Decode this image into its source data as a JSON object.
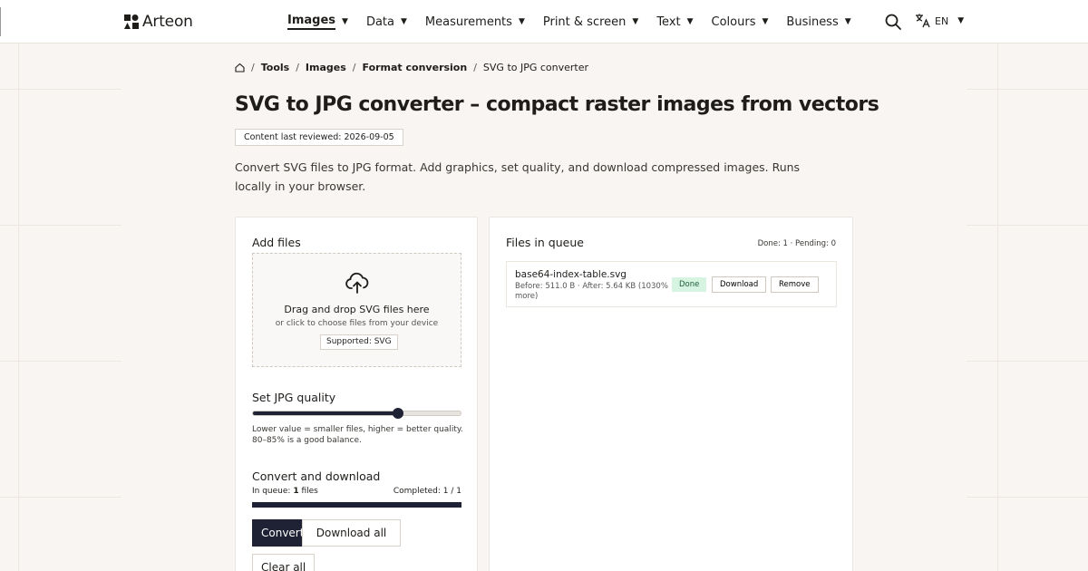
{
  "header": {
    "brand": "Arteon",
    "nav": [
      {
        "label": "Images",
        "active": true
      },
      {
        "label": "Data",
        "active": false
      },
      {
        "label": "Measurements",
        "active": false
      },
      {
        "label": "Print & screen",
        "active": false
      },
      {
        "label": "Text",
        "active": false
      },
      {
        "label": "Colours",
        "active": false
      },
      {
        "label": "Business",
        "active": false
      }
    ],
    "language": "EN",
    "icons": {
      "search": "search-icon",
      "language": "translate-icon",
      "caret": "caret-down-icon"
    }
  },
  "breadcrumb": {
    "home_icon": "home-icon",
    "items": [
      "Tools",
      "Images",
      "Format conversion",
      "SVG to JPG converter"
    ]
  },
  "page": {
    "title": "SVG to JPG converter – compact raster images from vectors",
    "reviewed": "Content last reviewed: 2026-09-05",
    "intro": "Convert SVG files to JPG format. Add graphics, set quality, and download compressed images. Runs locally in your browser."
  },
  "add_files": {
    "title": "Add files",
    "icon": "cloud-upload-icon",
    "drop_main": "Drag and drop SVG files here",
    "drop_sub": "or click to choose files from your device",
    "supported": "Supported: SVG"
  },
  "quality": {
    "title": "Set JPG quality",
    "value_fraction": 0.7,
    "hint": "Lower value = smaller files, higher = better quality. 80–85% is a good balance."
  },
  "convert": {
    "title": "Convert and download",
    "in_queue_label": "In queue:",
    "in_queue_count": "1",
    "in_queue_unit": "files",
    "completed": "Completed: 1 / 1",
    "progress_fraction": 1.0,
    "convert_label": "Convert",
    "download_all_label": "Download all",
    "clear_all_label": "Clear all"
  },
  "queue": {
    "title": "Files in queue",
    "status": "Done: 1 · Pending: 0",
    "files": [
      {
        "name": "base64-index-table.svg",
        "meta": "Before: 511.0 B · After: 5.64 KB (1030% more)",
        "status": "Done",
        "download_label": "Download",
        "remove_label": "Remove"
      }
    ]
  },
  "colors": {
    "accent": "#1e2234",
    "done_bg": "#d7f4e2",
    "done_text": "#1d5c37"
  }
}
